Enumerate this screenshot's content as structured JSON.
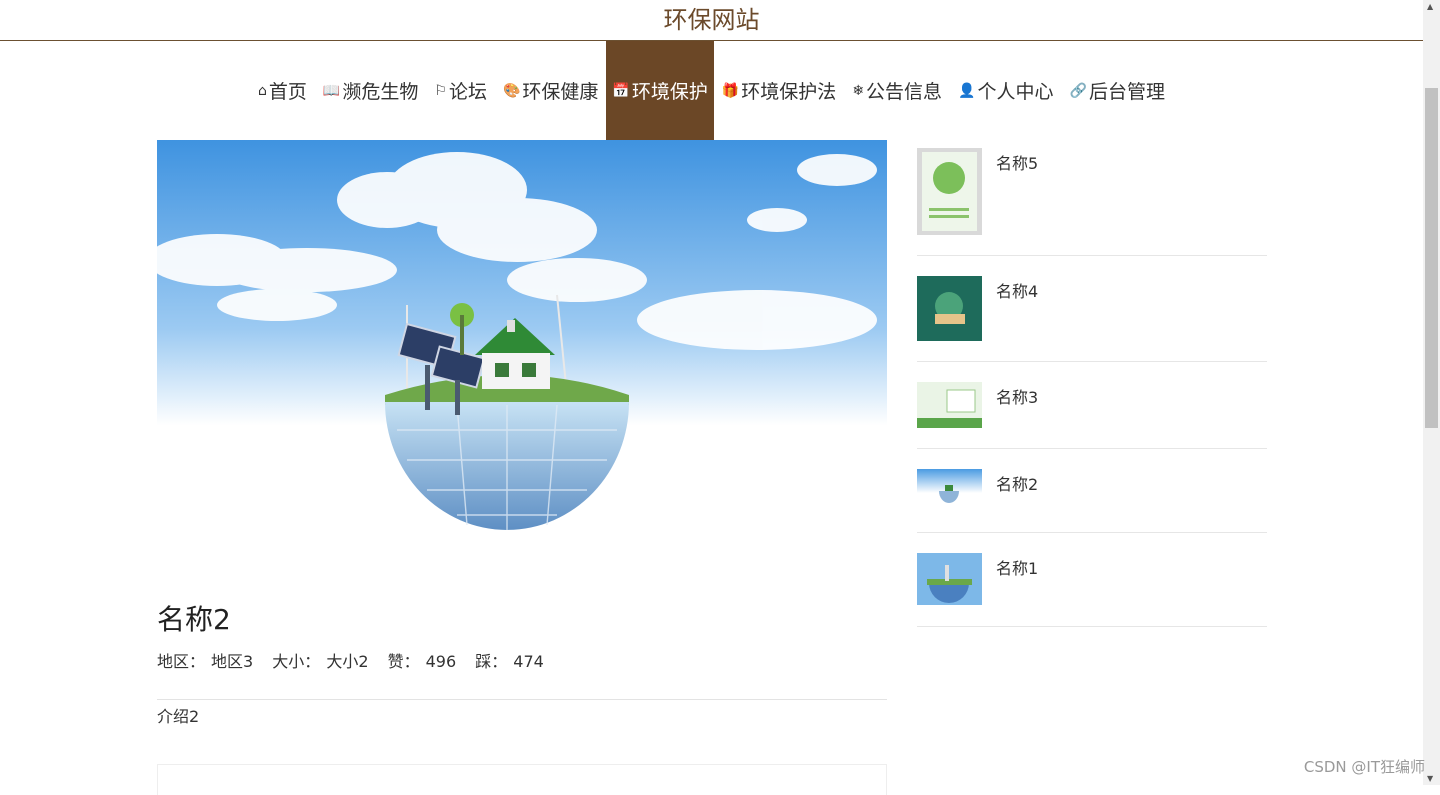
{
  "header": {
    "title": "环保网站"
  },
  "nav": {
    "items": [
      {
        "label": "首页",
        "icon": "home-icon",
        "glyph": "⌂",
        "active": false
      },
      {
        "label": "濒危生物",
        "icon": "book-icon",
        "glyph": "📖",
        "active": false
      },
      {
        "label": "论坛",
        "icon": "flag-icon",
        "glyph": "⚐",
        "active": false
      },
      {
        "label": "环保健康",
        "icon": "palette-icon",
        "glyph": "🎨",
        "active": false
      },
      {
        "label": "环境保护",
        "icon": "calendar-icon",
        "glyph": "📅",
        "active": true
      },
      {
        "label": "环境保护法",
        "icon": "gift-icon",
        "glyph": "🎁",
        "active": false
      },
      {
        "label": "公告信息",
        "icon": "snowflake-icon",
        "glyph": "❄",
        "active": false
      },
      {
        "label": "个人中心",
        "icon": "user-icon",
        "glyph": "👤",
        "active": false
      },
      {
        "label": "后台管理",
        "icon": "link-icon",
        "glyph": "🔗",
        "active": false
      }
    ]
  },
  "detail": {
    "title": "名称2",
    "meta": [
      {
        "label": "地区：",
        "value": "地区3"
      },
      {
        "label": "大小：",
        "value": "大小2"
      },
      {
        "label": "赞：",
        "value": "496"
      },
      {
        "label": "踩：",
        "value": "474"
      }
    ],
    "intro": "介绍2"
  },
  "sidebar": {
    "items": [
      {
        "name": "名称5"
      },
      {
        "name": "名称4"
      },
      {
        "name": "名称3"
      },
      {
        "name": "名称2"
      },
      {
        "name": "名称1"
      }
    ]
  },
  "watermark": "CSDN @IT狂编师",
  "colors": {
    "brand": "#6b4726",
    "title": "#6b4a2b",
    "sky": "#5aa6e6"
  }
}
